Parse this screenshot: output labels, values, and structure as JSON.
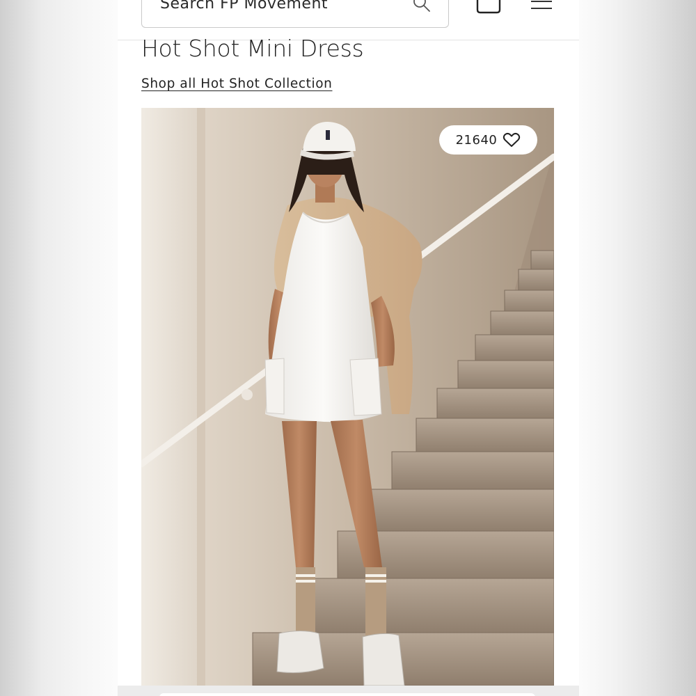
{
  "search": {
    "placeholder": "Search FP Movement"
  },
  "product": {
    "title": "Hot Shot Mini Dress",
    "collection_link": "Shop all Hot Shot Collection"
  },
  "image": {
    "likes": "21640"
  },
  "icons": {
    "search": "search-icon",
    "bag": "bag-icon",
    "menu": "menu-icon",
    "heart": "heart-icon"
  },
  "colors": {
    "text": "#222222",
    "header_border": "#e3e3e3"
  }
}
